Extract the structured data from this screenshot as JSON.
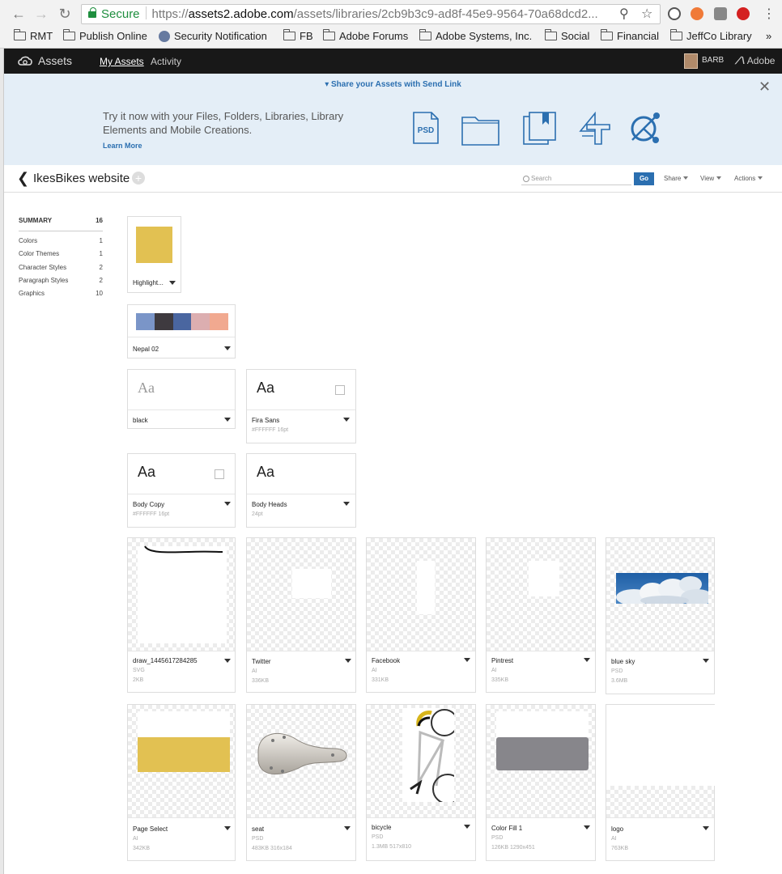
{
  "browser": {
    "secure_label": "Secure",
    "url_scheme": "https://",
    "url_host": "assets2.adobe.com",
    "url_path": "/assets/libraries/2cb9b3c9-ad8f-45e9-9564-70a68dcd2...",
    "bookmarks": [
      "RMT",
      "Publish Online",
      "Security Notification",
      "FB",
      "Adobe Forums",
      "Adobe Systems, Inc.",
      "Social",
      "Financial",
      "JeffCo Library"
    ],
    "overflow": "»"
  },
  "header": {
    "brand": "Assets",
    "nav": [
      "My Assets",
      "Activity"
    ],
    "user": "BARB",
    "adobe": "Adobe"
  },
  "banner": {
    "share_link": "▾ Share your Assets with Send Link",
    "pitch": "Try it now with your Files, Folders, Libraries, Library Elements and Mobile Creations.",
    "learn_more": "Learn More",
    "psd_label": "PSD"
  },
  "library": {
    "title": "IkesBikes website",
    "search_placeholder": "Search",
    "go": "Go",
    "menus": [
      "Share",
      "View",
      "Actions"
    ]
  },
  "sidebar": {
    "summary_label": "SUMMARY",
    "summary_count": "16",
    "items": [
      {
        "label": "Colors",
        "count": "1"
      },
      {
        "label": "Color Themes",
        "count": "1"
      },
      {
        "label": "Character Styles",
        "count": "2"
      },
      {
        "label": "Paragraph Styles",
        "count": "2"
      },
      {
        "label": "Graphics",
        "count": "10"
      }
    ]
  },
  "colors": {
    "highlight": {
      "name": "Highlight...",
      "swatch": "#e2c152"
    },
    "theme": {
      "name": "Nepal 02",
      "swatches": [
        "#7a95c8",
        "#3e3a3f",
        "#4a66a0",
        "#dcaeb0",
        "#f1a990"
      ]
    }
  },
  "char_styles": [
    {
      "preview": "Aa",
      "name": "black",
      "meta": ""
    },
    {
      "preview": "Aa",
      "name": "Fira Sans",
      "meta": "#FFFFFF   16pt"
    }
  ],
  "para_styles": [
    {
      "preview": "Aa",
      "name": "Body Copy",
      "meta": "#FFFFFF   16pt"
    },
    {
      "preview": "Aa",
      "name": "Body Heads",
      "meta": "24pt"
    }
  ],
  "graphics": [
    {
      "name": "draw_1445617284285",
      "type": "SVG",
      "size": "2KB"
    },
    {
      "name": "Twitter",
      "type": "AI",
      "size": "336KB"
    },
    {
      "name": "Facebook",
      "type": "AI",
      "size": "331KB"
    },
    {
      "name": "Pintrest",
      "type": "AI",
      "size": "335KB"
    },
    {
      "name": "blue sky",
      "type": "PSD",
      "size": "3.6MB"
    },
    {
      "name": "Page Select",
      "type": "AI",
      "size": "342KB"
    },
    {
      "name": "seat",
      "type": "PSD",
      "size": "483KB   316x184"
    },
    {
      "name": "bicycle",
      "type": "PSD",
      "size": "1.3MB   517x810"
    },
    {
      "name": "Color Fill 1",
      "type": "PSD",
      "size": "126KB   1290x451"
    },
    {
      "name": "logo",
      "type": "AI",
      "size": "763KB"
    }
  ],
  "graphic_colors": {
    "page_select": "#e2c152",
    "color_fill": "#87868b"
  }
}
